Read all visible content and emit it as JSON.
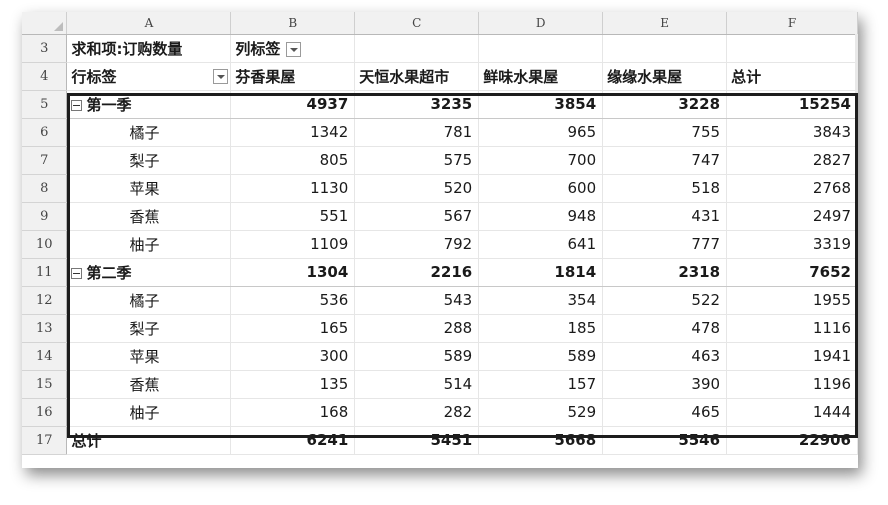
{
  "columns": [
    "",
    "A",
    "B",
    "C",
    "D",
    "E",
    "F"
  ],
  "header_row3": {
    "row_num": "3",
    "values_label": "求和项:订购数量",
    "col_labels": "列标签"
  },
  "header_row4": {
    "row_num": "4",
    "row_labels": "行标签",
    "stores": [
      "芬香果屋",
      "天恒水果超市",
      "鲜味水果屋",
      "缘缘水果屋",
      "总计"
    ]
  },
  "groups": [
    {
      "row_num": "5",
      "label": "第一季",
      "values": [
        "4937",
        "3235",
        "3854",
        "3228",
        "15254"
      ],
      "items": [
        {
          "row_num": "6",
          "label": "橘子",
          "values": [
            "1342",
            "781",
            "965",
            "755",
            "3843"
          ]
        },
        {
          "row_num": "7",
          "label": "梨子",
          "values": [
            "805",
            "575",
            "700",
            "747",
            "2827"
          ]
        },
        {
          "row_num": "8",
          "label": "苹果",
          "values": [
            "1130",
            "520",
            "600",
            "518",
            "2768"
          ]
        },
        {
          "row_num": "9",
          "label": "香蕉",
          "values": [
            "551",
            "567",
            "948",
            "431",
            "2497"
          ]
        },
        {
          "row_num": "10",
          "label": "柚子",
          "values": [
            "1109",
            "792",
            "641",
            "777",
            "3319"
          ]
        }
      ]
    },
    {
      "row_num": "11",
      "label": "第二季",
      "values": [
        "1304",
        "2216",
        "1814",
        "2318",
        "7652"
      ],
      "items": [
        {
          "row_num": "12",
          "label": "橘子",
          "values": [
            "536",
            "543",
            "354",
            "522",
            "1955"
          ]
        },
        {
          "row_num": "13",
          "label": "梨子",
          "values": [
            "165",
            "288",
            "185",
            "478",
            "1116"
          ]
        },
        {
          "row_num": "14",
          "label": "苹果",
          "values": [
            "300",
            "589",
            "589",
            "463",
            "1941"
          ]
        },
        {
          "row_num": "15",
          "label": "香蕉",
          "values": [
            "135",
            "514",
            "157",
            "390",
            "1196"
          ]
        },
        {
          "row_num": "16",
          "label": "柚子",
          "values": [
            "168",
            "282",
            "529",
            "465",
            "1444"
          ]
        }
      ]
    }
  ],
  "grand_total": {
    "row_num": "17",
    "label": "总计",
    "values": [
      "6241",
      "5451",
      "5668",
      "5546",
      "22906"
    ]
  }
}
